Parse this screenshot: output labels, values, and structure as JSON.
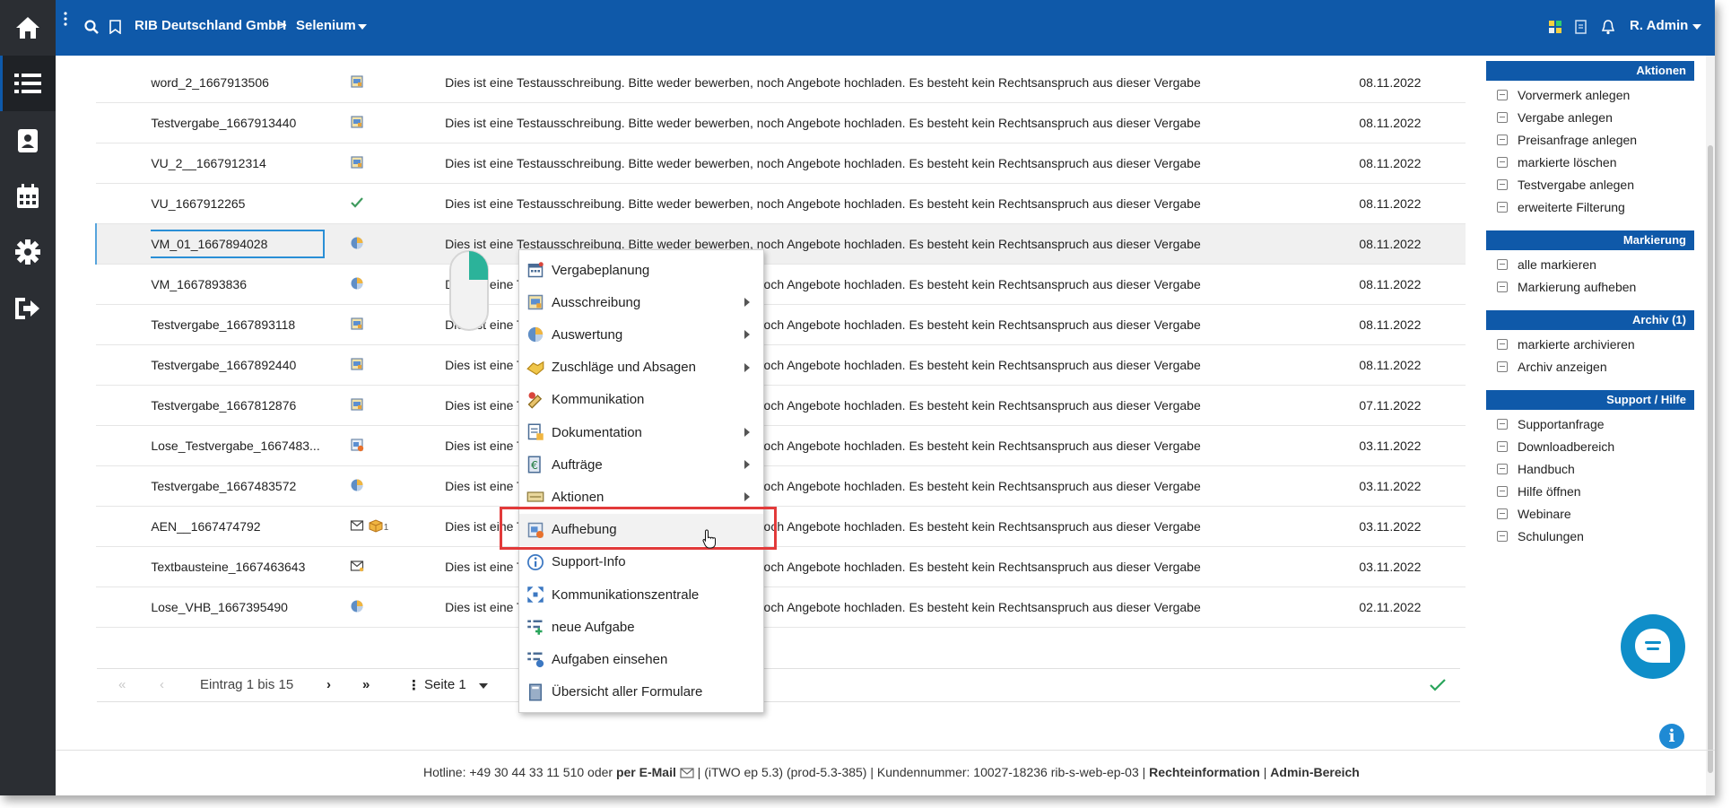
{
  "header": {
    "company": "RIB Deutschland GmbH",
    "breadcrumb_sep": ">",
    "project": "Selenium",
    "user": "R. Admin",
    "brand_color": "#0f59a9"
  },
  "left_nav": [
    "home-icon",
    "list-icon",
    "contacts-icon",
    "calendar-icon",
    "gear-icon",
    "logout-icon"
  ],
  "rows": [
    {
      "name": "word_2_1667913506",
      "icon": "tender-icon",
      "desc": "Dies ist eine Testausschreibung. Bitte weder bewerben, noch Angebote hochladen. Es besteht kein Rechtsanspruch aus dieser Vergabe",
      "date": "08.11.2022"
    },
    {
      "name": "Testvergabe_1667913440",
      "icon": "tender-icon",
      "desc": "Dies ist eine Testausschreibung. Bitte weder bewerben, noch Angebote hochladen. Es besteht kein Rechtsanspruch aus dieser Vergabe",
      "date": "08.11.2022"
    },
    {
      "name": "VU_2__1667912314",
      "icon": "tender-icon",
      "desc": "Dies ist eine Testausschreibung. Bitte weder bewerben, noch Angebote hochladen. Es besteht kein Rechtsanspruch aus dieser Vergabe",
      "date": "08.11.2022"
    },
    {
      "name": "VU_1667912265",
      "icon": "check-icon",
      "desc": "Dies ist eine Testausschreibung. Bitte weder bewerben, noch Angebote hochladen. Es besteht kein Rechtsanspruch aus dieser Vergabe",
      "date": "08.11.2022"
    },
    {
      "name": "VM_01_1667894028",
      "icon": "pie-icon",
      "desc": "Dies ist eine Testausschreibung. Bitte weder bewerben, noch Angebote hochladen. Es besteht kein Rechtsanspruch aus dieser Vergabe",
      "date": "08.11.2022",
      "selected": true
    },
    {
      "name": "VM_1667893836",
      "icon": "pie-icon",
      "desc": "Dies ist eine Testausschreibung. Bitte weder bewerben, noch Angebote hochladen. Es besteht kein Rechtsanspruch aus dieser Vergabe",
      "date": "08.11.2022"
    },
    {
      "name": "Testvergabe_1667893118",
      "icon": "tender-icon",
      "desc": "Dies ist eine Testausschreibung. Bitte weder bewerben, noch Angebote hochladen. Es besteht kein Rechtsanspruch aus dieser Vergabe",
      "date": "08.11.2022"
    },
    {
      "name": "Testvergabe_1667892440",
      "icon": "tender-icon",
      "desc": "Dies ist eine Testausschreibung. Bitte weder bewerben, noch Angebote hochladen. Es besteht kein Rechtsanspruch aus dieser Vergabe",
      "date": "08.11.2022"
    },
    {
      "name": "Testvergabe_1667812876",
      "icon": "tender-icon",
      "desc": "Dies ist eine Testausschreibung. Bitte weder bewerben, noch Angebote hochladen. Es besteht kein Rechtsanspruch aus dieser Vergabe",
      "date": "07.11.2022"
    },
    {
      "name": "Lose_Testvergabe_1667483...",
      "icon": "cancel-tender-icon",
      "desc": "Dies ist eine Testausschreibung. Bitte weder bewerben, noch Angebote hochladen. Es besteht kein Rechtsanspruch aus dieser Vergabe",
      "date": "03.11.2022"
    },
    {
      "name": "Testvergabe_1667483572",
      "icon": "pie-icon",
      "desc": "Dies ist eine Testausschreibung. Bitte weder bewerben, noch Angebote hochladen. Es besteht kein Rechtsanspruch aus dieser Vergabe",
      "date": "03.11.2022"
    },
    {
      "name": "AEN__1667474792",
      "icon": "mail-package-icon",
      "badge": "1",
      "desc": "Dies ist eine Testausschreibung. Bitte weder bewerben, noch Angebote hochladen. Es besteht kein Rechtsanspruch aus dieser Vergabe",
      "date": "03.11.2022"
    },
    {
      "name": "Textbausteine_1667463643",
      "icon": "mail-icon",
      "desc": "Dies ist eine Testausschreibung. Bitte weder bewerben, noch Angebote hochladen. Es besteht kein Rechtsanspruch aus dieser Vergabe",
      "date": "03.11.2022"
    },
    {
      "name": "Lose_VHB_1667395490",
      "icon": "pie-icon",
      "desc": "Dies ist eine Testausschreibung. Bitte weder bewerben, noch Angebote hochladen. Es besteht kein Rechtsanspruch aus dieser Vergabe",
      "date": "02.11.2022"
    }
  ],
  "pager": {
    "range": "Eintrag 1 bis 15",
    "page": "Seite 1"
  },
  "context_menu": [
    {
      "label": "Vergabeplanung",
      "icon": "calendar-plan-icon",
      "submenu": false
    },
    {
      "label": "Ausschreibung",
      "icon": "tender-icon",
      "submenu": true
    },
    {
      "label": "Auswertung",
      "icon": "pie-icon",
      "submenu": true
    },
    {
      "label": "Zuschläge und Absagen",
      "icon": "handshake-icon",
      "submenu": true
    },
    {
      "label": "Kommunikation",
      "icon": "communication-icon",
      "submenu": false
    },
    {
      "label": "Dokumentation",
      "icon": "document-icon",
      "submenu": true
    },
    {
      "label": "Aufträge",
      "icon": "orders-icon",
      "submenu": true
    },
    {
      "label": "Aktionen",
      "icon": "actions-icon",
      "submenu": true
    },
    {
      "label": "Aufhebung",
      "icon": "cancel-tender-icon",
      "submenu": false,
      "highlighted": true
    },
    {
      "label": "Support-Info",
      "icon": "info-icon",
      "submenu": false
    },
    {
      "label": "Kommunikationszentrale",
      "icon": "hub-icon",
      "submenu": false
    },
    {
      "label": "neue Aufgabe",
      "icon": "new-task-icon",
      "submenu": false
    },
    {
      "label": "Aufgaben einsehen",
      "icon": "view-tasks-icon",
      "submenu": false
    },
    {
      "label": "Übersicht aller Formulare",
      "icon": "forms-icon",
      "submenu": false
    }
  ],
  "sidebar": [
    {
      "title": "Aktionen",
      "items": [
        "Vorvermerk anlegen",
        "Vergabe anlegen",
        "Preisanfrage anlegen",
        "markierte löschen",
        "Testvergabe anlegen",
        "erweiterte Filterung"
      ]
    },
    {
      "title": "Markierung",
      "items": [
        "alle markieren",
        "Markierung aufheben"
      ]
    },
    {
      "title": "Archiv (1)",
      "items": [
        "markierte archivieren",
        "Archiv anzeigen"
      ]
    },
    {
      "title": "Support / Hilfe",
      "items": [
        "Supportanfrage",
        "Downloadbereich",
        "Handbuch",
        "Hilfe öffnen",
        "Webinare",
        "Schulungen"
      ]
    }
  ],
  "footer": {
    "hotline": "Hotline: +49 30 44 33 11 510 oder",
    "email": "per E-Mail",
    "sep1": "|",
    "version": "(iTWO ep 5.3) (prod-5.3-385)",
    "sep2": "|",
    "customer": "Kundennummer: 10027-18236 rib-s-web-ep-03 |",
    "legal": "Rechteinformation",
    "sep3": "|",
    "admin": "Admin-Bereich"
  }
}
